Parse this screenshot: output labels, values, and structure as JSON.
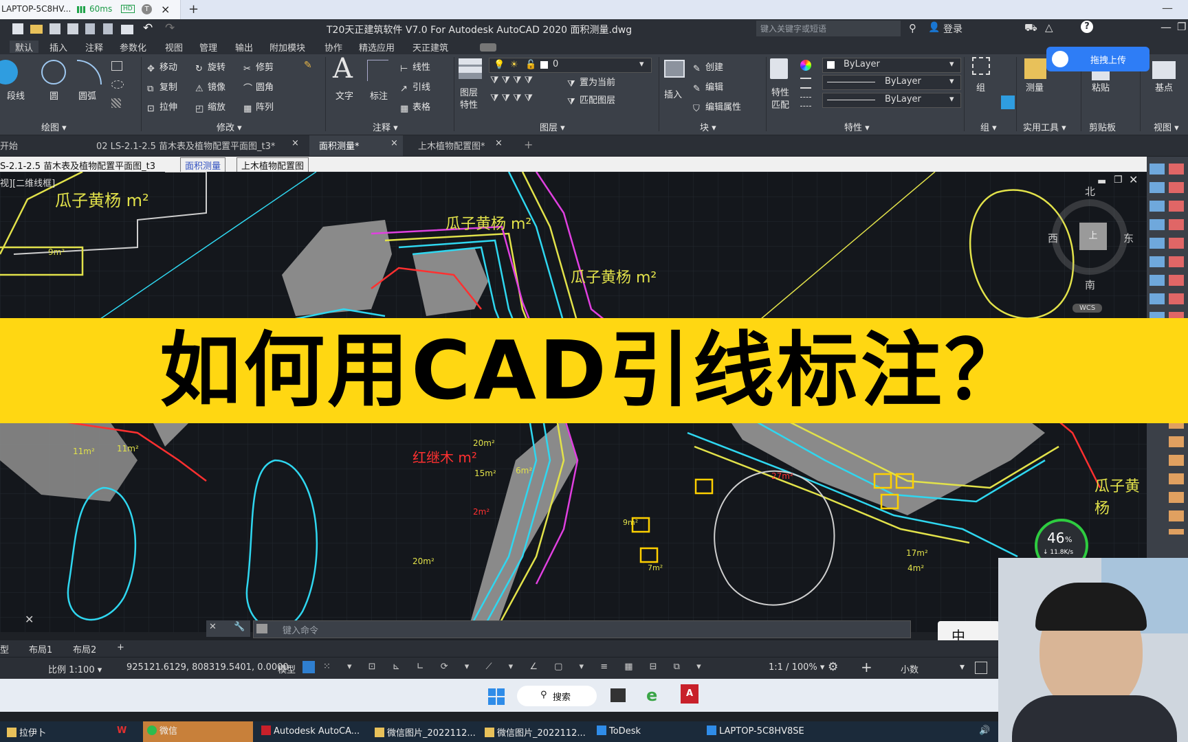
{
  "remote": {
    "host_tab": "LAPTOP-5C8HV...",
    "latency": "60ms",
    "hd_badge": "HD",
    "t_badge": "T",
    "close": "×",
    "new_tab": "+",
    "minimize": "—"
  },
  "titlebar": {
    "title": "T20天正建筑软件 V7.0 For Autodesk AutoCAD 2020    面积测量.dwg",
    "search_placeholder": "键入关键字或短语",
    "login": "登录"
  },
  "ribbon_tabs": [
    "默认",
    "插入",
    "注释",
    "参数化",
    "视图",
    "管理",
    "输出",
    "附加模块",
    "协作",
    "精选应用",
    "天正建筑"
  ],
  "ribbon": {
    "draw": {
      "polyline": "段线",
      "circle": "圆",
      "arc": "圆弧",
      "panel": "绘图 ▾"
    },
    "modify": {
      "move": "移动",
      "rotate": "旋转",
      "trim": "修剪",
      "copy": "复制",
      "mirror": "镜像",
      "fillet": "圆角",
      "stretch": "拉伸",
      "scale": "缩放",
      "array": "阵列",
      "panel": "修改 ▾"
    },
    "annotate": {
      "text": "文字",
      "dim": "标注",
      "linear": "线性",
      "leader": "引线",
      "table": "表格",
      "panel": "注释 ▾"
    },
    "layers": {
      "props": "图层\n特性",
      "layer_value": "0",
      "set_current": "置为当前",
      "match": "匹配图层",
      "panel": "图层 ▾"
    },
    "block": {
      "insert": "插入",
      "create": "创建",
      "edit": "编辑",
      "edit_attr": "编辑属性",
      "panel": "块 ▾"
    },
    "properties": {
      "match": "特性\n匹配",
      "color": "ByLayer",
      "linetype": "ByLayer",
      "lineweight": "ByLayer",
      "panel": "特性 ▾"
    },
    "group": {
      "group": "组",
      "panel": "组 ▾"
    },
    "utilities": {
      "measure": "测量",
      "panel": "实用工具 ▾"
    },
    "clipboard": {
      "paste": "粘贴",
      "panel": "剪贴板"
    },
    "view": {
      "base": "基点",
      "panel": "视图 ▾"
    },
    "upload": "拖拽上传"
  },
  "doc_tabs": [
    "开始",
    "02 LS-2.1-2.5 苗木表及植物配置平面图_t3*",
    "面积测量*",
    "上木植物配置图*"
  ],
  "file_tabs": [
    "S-2.1-2.5  苗木表及植物配置平面图_t3",
    "面积测量",
    "上木植物配置图"
  ],
  "viewport_label": "视][二维线框]",
  "viewcube": {
    "north": "北",
    "south": "南",
    "east": "东",
    "west": "西",
    "top": "上",
    "wcs": "WCS"
  },
  "drawing_labels": [
    "瓜子黄杨  m²",
    "9m²",
    "瓜子黄杨  m²",
    "瓜子黄杨  m²",
    "11m²",
    "11m²",
    "红继木  m²",
    "20m²",
    "15m²",
    "6m²",
    "2m²",
    "20m²",
    "27m²",
    "17m²",
    "4m²",
    "瓜子黄杨",
    "9m²",
    "7m²"
  ],
  "banner": "如何用CAD引线标注？",
  "command": {
    "placeholder": "键入命令"
  },
  "layout_tabs": [
    "型",
    "布局1",
    "布局2",
    "+"
  ],
  "status": {
    "scale": "比例 1:100 ▾",
    "coords": "925121.6129, 808319.5401, 0.0000",
    "model": "模型",
    "anno_scale": "1:1 / 100% ▾",
    "units": "小数"
  },
  "ime": {
    "mode": "中"
  },
  "net": {
    "percent": "46",
    "percent_sign": "%",
    "speed": "↓ 11.8K/s"
  },
  "win_taskbar": {
    "search": "搜索"
  },
  "old_taskbar": [
    "拉伊卜",
    "微信",
    "Autodesk AutoCA...",
    "微信图片_2022112...",
    "微信图片_2022112...",
    "ToDesk",
    "LAPTOP-5C8HV8SE"
  ]
}
